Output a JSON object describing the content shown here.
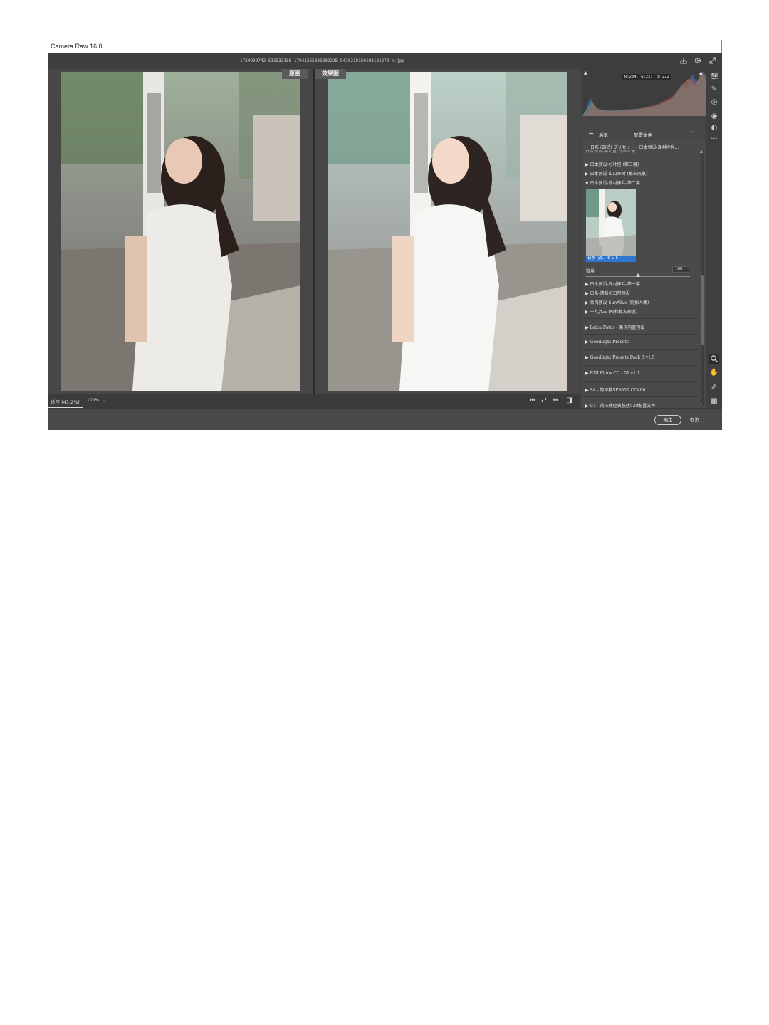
{
  "app": {
    "title": "Camera Raw 16.0"
  },
  "file": {
    "name": "1760939742_511533186_17941365031002225_8420218150193181279_n.jpg"
  },
  "toolbar": {
    "save_icon": "save-icon",
    "settings_icon": "gear-icon",
    "fullscreen_icon": "fullscreen-icon"
  },
  "preview": {
    "before_label": "原图",
    "after_label": "效果图"
  },
  "status": {
    "fit_label": "适应 (43.2%)",
    "zoom_value": "100%"
  },
  "histogram": {
    "r": "R:234",
    "g": "G:227",
    "b": "B:222"
  },
  "panel": {
    "back_label": "后退",
    "title": "配置文件",
    "more": "···",
    "group_header": "日系 (调适) プリセット - 日本预设-泽村拝兵...",
    "partial_item": "日本预设-早川直·日系人像",
    "items_top": [
      "▶ 日本预设-杉叶信 (第二套)",
      "▶ 日本预设-山口幸树 (都市风景)",
      "▼ 日本预设-泽村拝兵-第二套"
    ],
    "thumb_caption": "日系 (调... セット",
    "amount_label": "数量",
    "amount_value": "100",
    "amount_fraction": 0.5,
    "items_sub": [
      "▶ 日本预设-泽村拝兵-第一套",
      "▶ 日系-清新の日常预设",
      "▶ 台湾预设-SunAlive (街拍人像)",
      "▶ 一九九三 (昭和复古预设)"
    ],
    "groups": [
      "▶ Leica Fotos - 莱卡内置预设",
      "▶ Goodlight Presets",
      "▶ Goodlight Presets Pack 3 v1.5",
      "▶ RNI Films CC - 01 v1.1",
      "▶ S4 - 简泽教SP3000 CC400",
      "▶ C1 - 简泽教经典胶达520配置文件"
    ]
  },
  "buttons": {
    "ok": "确定",
    "cancel": "取消"
  }
}
